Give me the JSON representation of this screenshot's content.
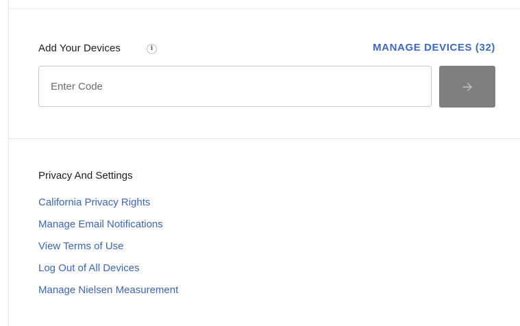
{
  "devices": {
    "title": "Add Your Devices",
    "info_glyph": "i",
    "manage_link": "MANAGE DEVICES (32)",
    "code_input": {
      "placeholder": "Enter Code",
      "value": ""
    },
    "submit_icon": "arrow-right-icon"
  },
  "privacy": {
    "title": "Privacy And Settings",
    "links": [
      "California Privacy Rights",
      "Manage Email Notifications",
      "View Terms of Use",
      "Log Out of All Devices",
      "Manage Nielsen Measurement"
    ]
  },
  "colors": {
    "link": "#3b64bf",
    "heading_link": "#3d68c2",
    "submit_bg": "#7f7f7f",
    "text": "#1c1c1c"
  }
}
